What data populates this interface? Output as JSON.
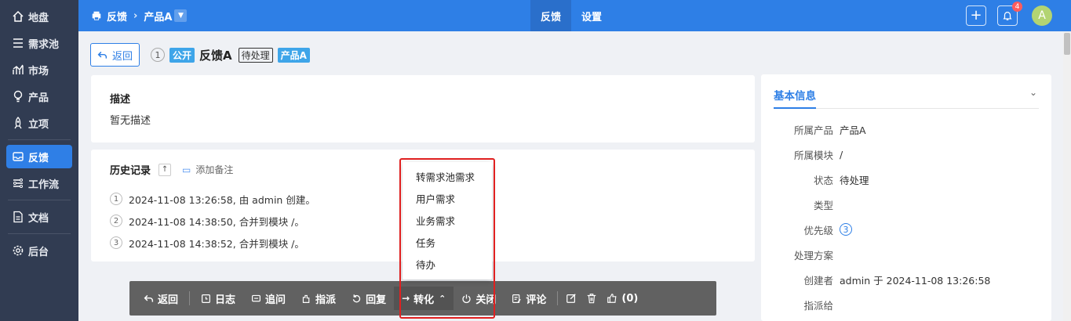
{
  "sidebar": {
    "items": [
      {
        "label": "地盘",
        "icon": "home-icon"
      },
      {
        "label": "需求池",
        "icon": "list-icon"
      },
      {
        "label": "市场",
        "icon": "chart-icon"
      },
      {
        "label": "产品",
        "icon": "bulb-icon"
      },
      {
        "label": "立项",
        "icon": "rocket-icon"
      },
      {
        "label": "反馈",
        "icon": "feedback-icon",
        "active": true
      },
      {
        "label": "工作流",
        "icon": "workflow-icon"
      },
      {
        "label": "文档",
        "icon": "doc-icon"
      },
      {
        "label": "后台",
        "icon": "gear-icon"
      }
    ]
  },
  "topbar": {
    "crumb_root": "反馈",
    "crumb_product": "产品A",
    "tabs": [
      "反馈",
      "设置"
    ],
    "notification_count": "4",
    "avatar_letter": "A"
  },
  "header": {
    "back_label": "返回",
    "index": "1",
    "public_tag": "公开",
    "title": "反馈A",
    "status_tag": "待处理",
    "product_tag": "产品A"
  },
  "description": {
    "heading": "描述",
    "text": "暂无描述"
  },
  "history": {
    "heading": "历史记录",
    "add_note": "添加备注",
    "entries": [
      {
        "n": "1",
        "text": "2024-11-08 13:26:58, 由 admin 创建。"
      },
      {
        "n": "2",
        "text": "2024-11-08 14:38:50, 合并到模块 /。"
      },
      {
        "n": "3",
        "text": "2024-11-08 14:38:52, 合并到模块 /。"
      }
    ]
  },
  "side": {
    "tab": "基本信息",
    "fields": [
      {
        "k": "所属产品",
        "v": "产品A"
      },
      {
        "k": "所属模块",
        "v": "/"
      },
      {
        "k": "状态",
        "v": "待处理"
      },
      {
        "k": "类型",
        "v": ""
      },
      {
        "k": "优先级",
        "v": "3"
      },
      {
        "k": "处理方案",
        "v": ""
      },
      {
        "k": "创建者",
        "v": "admin 于 2024-11-08 13:26:58"
      },
      {
        "k": "指派给",
        "v": ""
      }
    ]
  },
  "toolbar": {
    "back": "返回",
    "log": "日志",
    "ask": "追问",
    "assign": "指派",
    "reply": "回复",
    "convert": "转化",
    "close": "关闭",
    "comment": "评论",
    "like": "(0)"
  },
  "convert_menu": {
    "items": [
      "转需求池需求",
      "用户需求",
      "业务需求",
      "任务",
      "待办"
    ]
  },
  "colors": {
    "accent": "#2e7fe6",
    "sidebar_bg": "#313c52",
    "highlight_box": "#e02020"
  }
}
